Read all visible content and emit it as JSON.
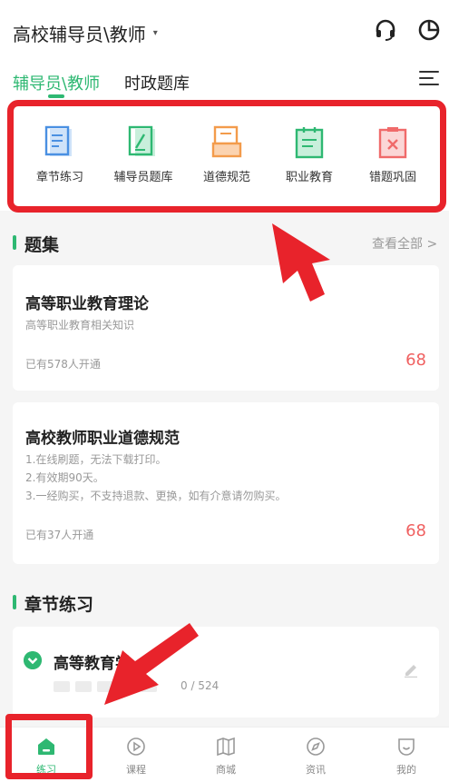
{
  "header": {
    "title": "高校辅导员\\教师",
    "caret": "▾"
  },
  "tabs": [
    {
      "label": "辅导员\\教师",
      "active": true
    },
    {
      "label": "时政题库",
      "active": false
    }
  ],
  "quick_nav": [
    {
      "label": "章节练习",
      "icon": "notebook-icon",
      "color": "#4a90e2"
    },
    {
      "label": "辅导员题库",
      "icon": "pen-document-icon",
      "color": "#2eb872"
    },
    {
      "label": "道德规范",
      "icon": "document-box-icon",
      "color": "#f39b4b"
    },
    {
      "label": "职业教育",
      "icon": "clipboard-icon",
      "color": "#2eb872"
    },
    {
      "label": "错题巩固",
      "icon": "wrong-clipboard-icon",
      "color": "#f06a6a"
    }
  ],
  "question_sets": {
    "title": "题集",
    "view_all": "查看全部 >",
    "items": [
      {
        "title": "高等职业教育理论",
        "description": [
          "高等职业教育相关知识"
        ],
        "subscribers": "已有578人开通",
        "price": "68"
      },
      {
        "title": "高校教师职业道德规范",
        "description": [
          "1.在线刷题，无法下载打印。",
          "2.有效期90天。",
          "3.一经购买，不支持退款、更换，如有介意请勿购买。"
        ],
        "subscribers": "已有37人开通",
        "price": "68"
      }
    ]
  },
  "chapter_practice": {
    "title": "章节练习",
    "item": {
      "title": "高等教育学",
      "progress": "0 / 524"
    }
  },
  "bottom_nav": [
    {
      "label": "练习",
      "icon": "home-icon",
      "active": true
    },
    {
      "label": "课程",
      "icon": "play-icon",
      "active": false
    },
    {
      "label": "商城",
      "icon": "book-icon",
      "active": false
    },
    {
      "label": "资讯",
      "icon": "compass-icon",
      "active": false
    },
    {
      "label": "我的",
      "icon": "profile-icon",
      "active": false
    }
  ],
  "colors": {
    "accent": "#2eb872",
    "price": "#f06060",
    "annotation": "#e8232b"
  }
}
